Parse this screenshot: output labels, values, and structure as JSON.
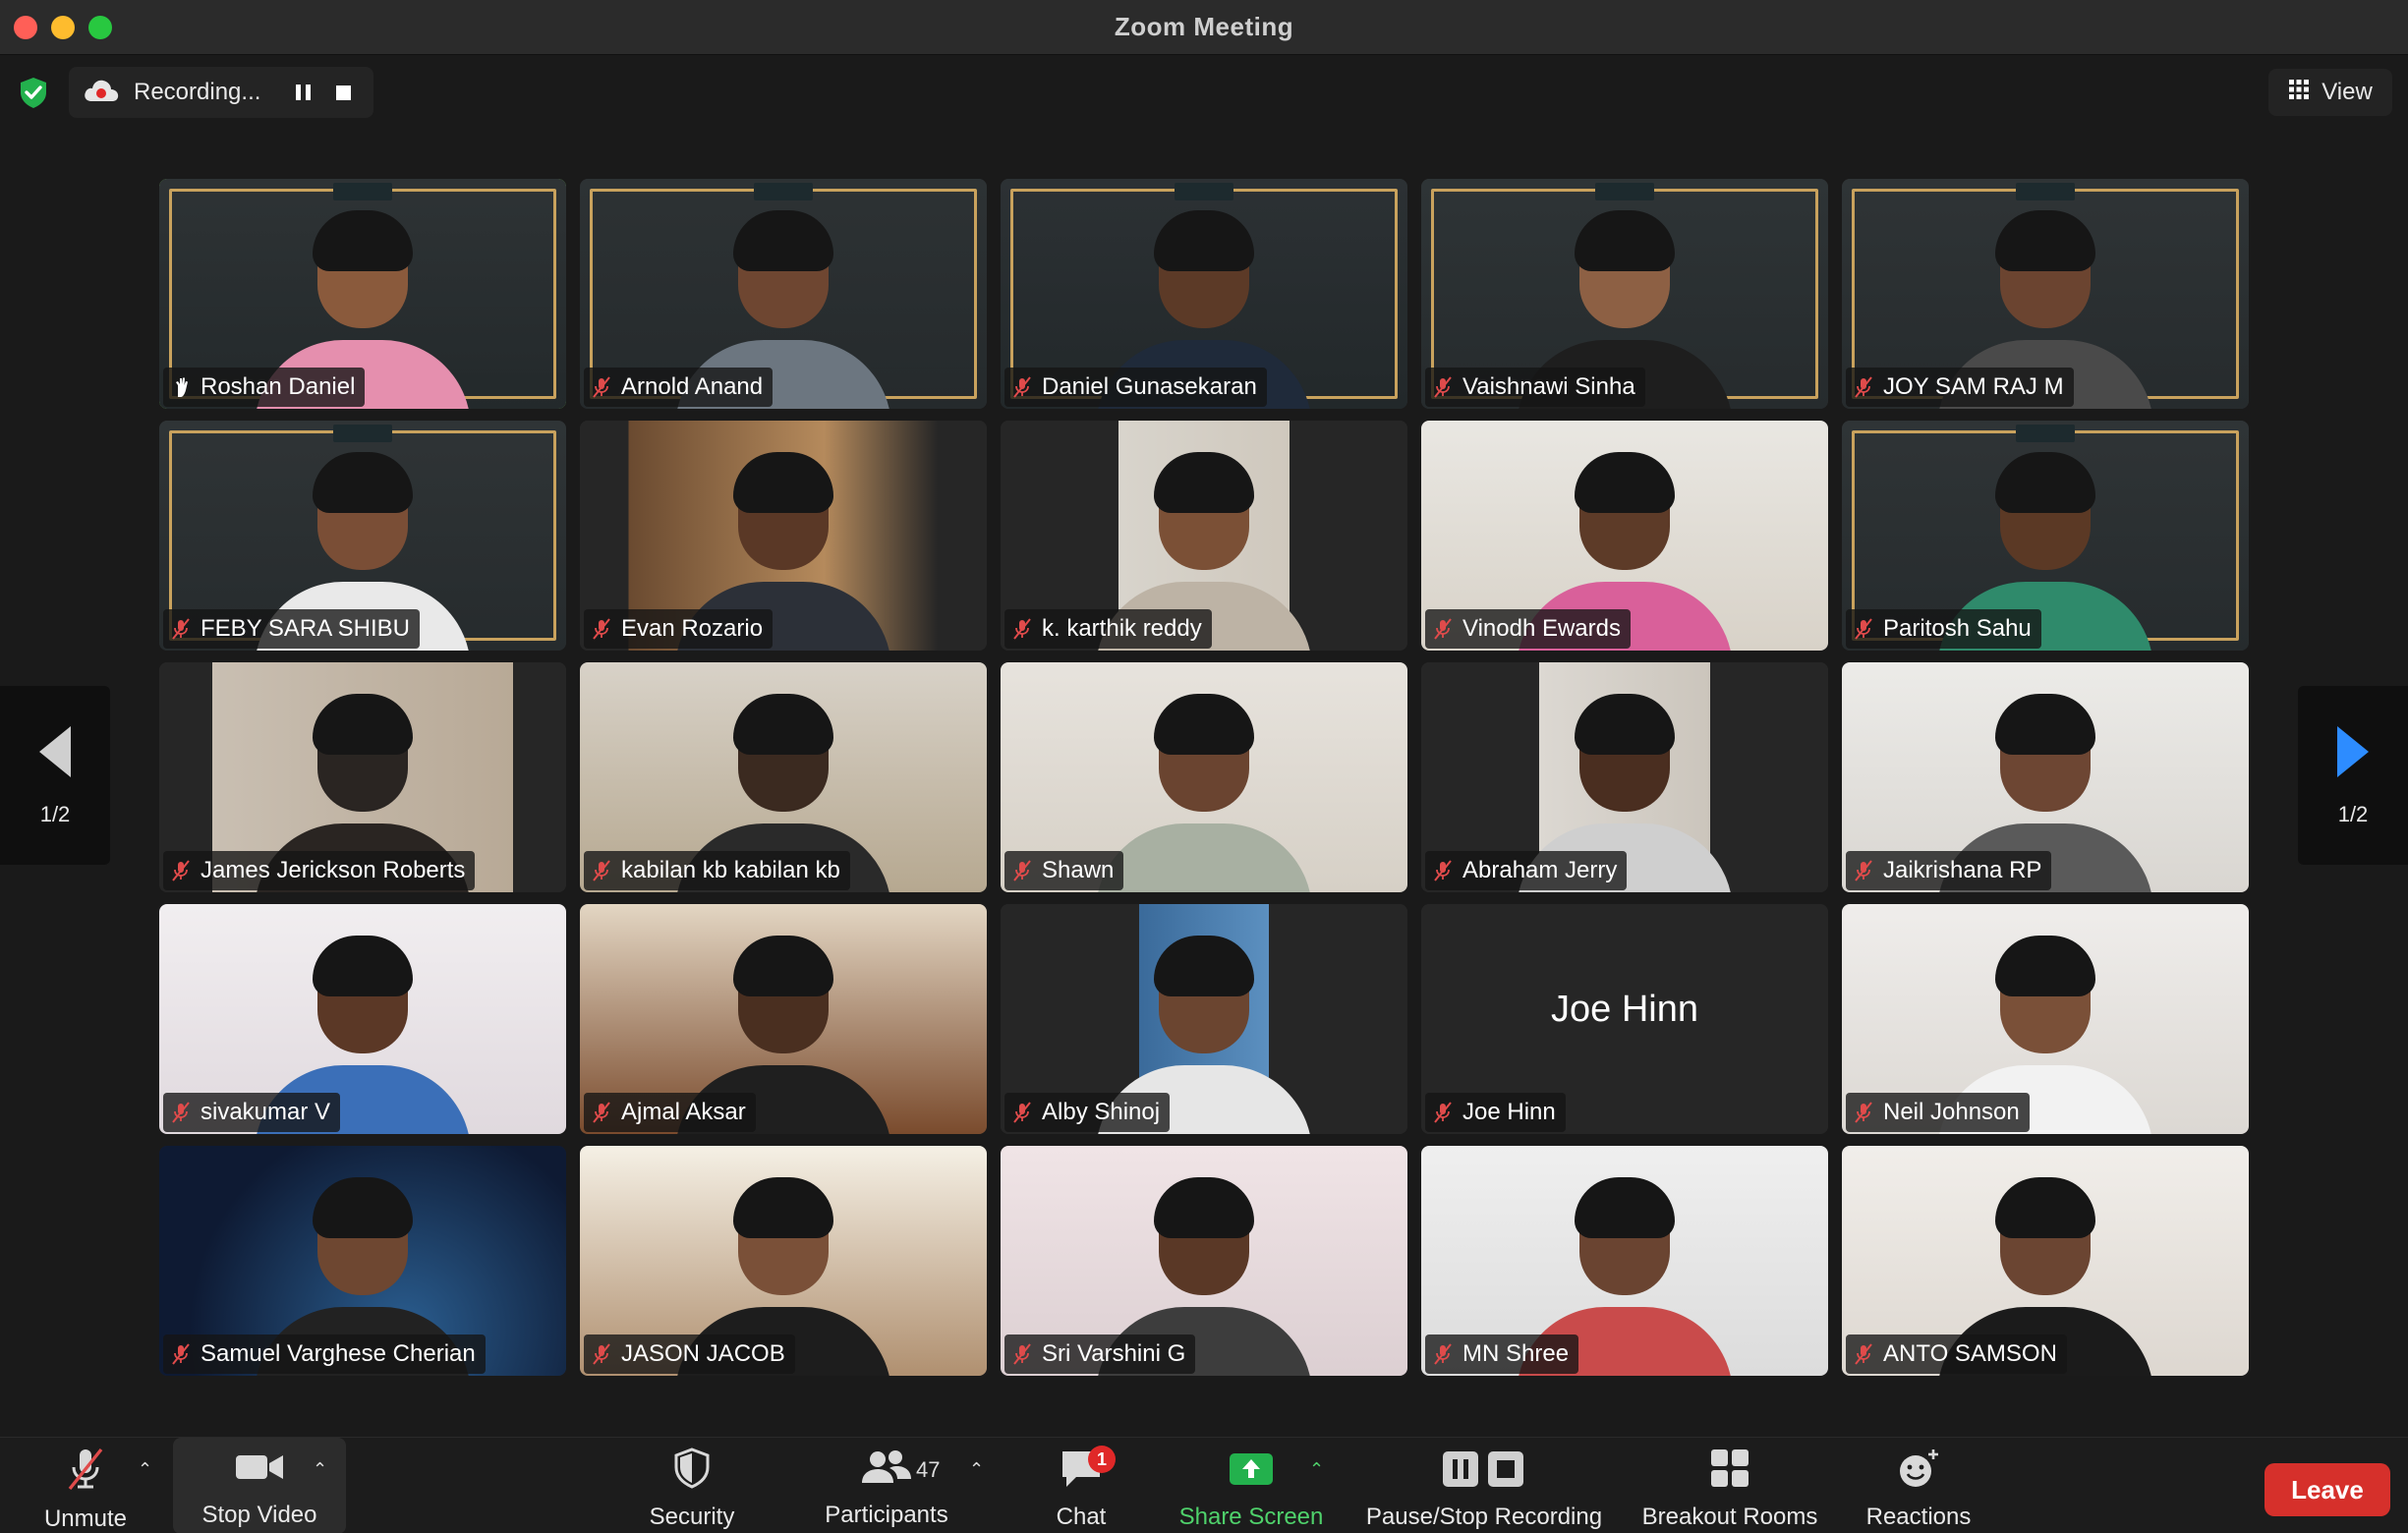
{
  "window": {
    "title": "Zoom Meeting"
  },
  "top_bar": {
    "recording_label": "Recording...",
    "view_label": "View"
  },
  "pagination": {
    "left_label": "1/2",
    "right_label": "1/2"
  },
  "participants": [
    {
      "name": "Roshan Daniel",
      "mic": "raised-hand",
      "active_speaker": true,
      "frame": true
    },
    {
      "name": "Arnold Anand",
      "mic": "muted",
      "frame": true
    },
    {
      "name": "Daniel Gunasekaran",
      "mic": "muted",
      "frame": true
    },
    {
      "name": "Vaishnawi Sinha",
      "mic": "muted",
      "frame": true
    },
    {
      "name": "JOY SAM RAJ M",
      "mic": "muted",
      "frame": true
    },
    {
      "name": "FEBY SARA SHIBU",
      "mic": "muted",
      "frame": true
    },
    {
      "name": "Evan Rozario",
      "mic": "muted"
    },
    {
      "name": "k. karthik reddy",
      "mic": "muted"
    },
    {
      "name": "Vinodh Ewards",
      "mic": "muted"
    },
    {
      "name": "Paritosh Sahu",
      "mic": "muted",
      "frame": true
    },
    {
      "name": "James Jerickson Roberts",
      "mic": "muted"
    },
    {
      "name": "kabilan kb kabilan kb",
      "mic": "muted"
    },
    {
      "name": "Shawn",
      "mic": "muted"
    },
    {
      "name": "Abraham Jerry",
      "mic": "muted"
    },
    {
      "name": "Jaikrishana RP",
      "mic": "muted"
    },
    {
      "name": "sivakumar V",
      "mic": "muted"
    },
    {
      "name": "Ajmal Aksar",
      "mic": "muted"
    },
    {
      "name": "Alby Shinoj",
      "mic": "muted"
    },
    {
      "name": "Joe Hinn",
      "mic": "muted",
      "video_off": true
    },
    {
      "name": "Neil Johnson",
      "mic": "muted"
    },
    {
      "name": "Samuel Varghese Cherian",
      "mic": "muted"
    },
    {
      "name": "JASON JACOB",
      "mic": "muted"
    },
    {
      "name": "Sri Varshini G",
      "mic": "muted"
    },
    {
      "name": "MN Shree",
      "mic": "muted"
    },
    {
      "name": "ANTO SAMSON",
      "mic": "muted"
    }
  ],
  "toolbar": {
    "unmute": "Unmute",
    "stop_video": "Stop Video",
    "security": "Security",
    "participants": "Participants",
    "participants_count": "47",
    "chat": "Chat",
    "chat_badge": "1",
    "share_screen": "Share Screen",
    "pause_stop_recording": "Pause/Stop Recording",
    "breakout_rooms": "Breakout Rooms",
    "reactions": "Reactions",
    "leave": "Leave"
  },
  "colors": {
    "active_speaker_border": "#7ed957",
    "share_green": "#4fd16b",
    "leave_red": "#d6302b",
    "mute_red": "#e04b4b",
    "page_arrow_blue": "#2d8cff"
  }
}
